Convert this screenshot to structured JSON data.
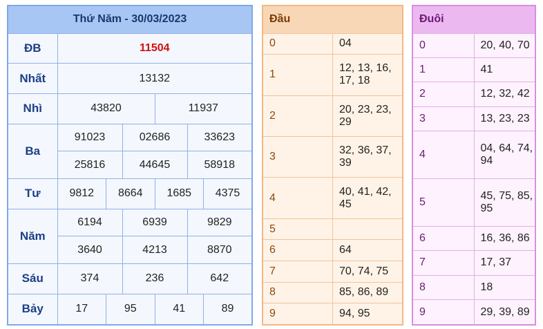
{
  "results": {
    "title": "Thứ Năm - 30/03/2023",
    "db": {
      "label": "ĐB",
      "value": "11504"
    },
    "nhat": {
      "label": "Nhất",
      "value": "13132"
    },
    "nhi": {
      "label": "Nhì",
      "values": [
        "43820",
        "11937"
      ]
    },
    "ba": {
      "label": "Ba",
      "values": [
        "91023",
        "02686",
        "33623",
        "25816",
        "44645",
        "58918"
      ]
    },
    "tu": {
      "label": "Tư",
      "values": [
        "9812",
        "8664",
        "1685",
        "4375"
      ]
    },
    "nam": {
      "label": "Năm",
      "values": [
        "6194",
        "6939",
        "9829",
        "3640",
        "4213",
        "8870"
      ]
    },
    "sau": {
      "label": "Sáu",
      "values": [
        "374",
        "236",
        "642"
      ]
    },
    "bay": {
      "label": "Bảy",
      "values": [
        "17",
        "95",
        "41",
        "89"
      ]
    }
  },
  "dau": {
    "header": "Đầu",
    "rows": [
      {
        "digit": "0",
        "values": "04"
      },
      {
        "digit": "1",
        "values": "12, 13, 16, 17, 18"
      },
      {
        "digit": "2",
        "values": "20, 23, 23, 29"
      },
      {
        "digit": "3",
        "values": "32, 36, 37, 39"
      },
      {
        "digit": "4",
        "values": "40, 41, 42, 45"
      },
      {
        "digit": "5",
        "values": ""
      },
      {
        "digit": "6",
        "values": "64"
      },
      {
        "digit": "7",
        "values": "70, 74, 75"
      },
      {
        "digit": "8",
        "values": "85, 86, 89"
      },
      {
        "digit": "9",
        "values": "94, 95"
      }
    ]
  },
  "duoi": {
    "header": "Đuôi",
    "rows": [
      {
        "digit": "0",
        "values": "20, 40, 70"
      },
      {
        "digit": "1",
        "values": "41"
      },
      {
        "digit": "2",
        "values": "12, 32, 42"
      },
      {
        "digit": "3",
        "values": "13, 23, 23"
      },
      {
        "digit": "4",
        "values": "04, 64, 74, 94"
      },
      {
        "digit": "5",
        "values": "45, 75, 85, 95"
      },
      {
        "digit": "6",
        "values": "16, 36, 86"
      },
      {
        "digit": "7",
        "values": "17, 37"
      },
      {
        "digit": "8",
        "values": "18"
      },
      {
        "digit": "9",
        "values": "29, 39, 89"
      }
    ]
  },
  "colors": {
    "results_header": "#a7c6f4",
    "db_value": "#d20f0f",
    "dau_header": "#f8d7b7",
    "duoi_header": "#ecb8f0"
  }
}
